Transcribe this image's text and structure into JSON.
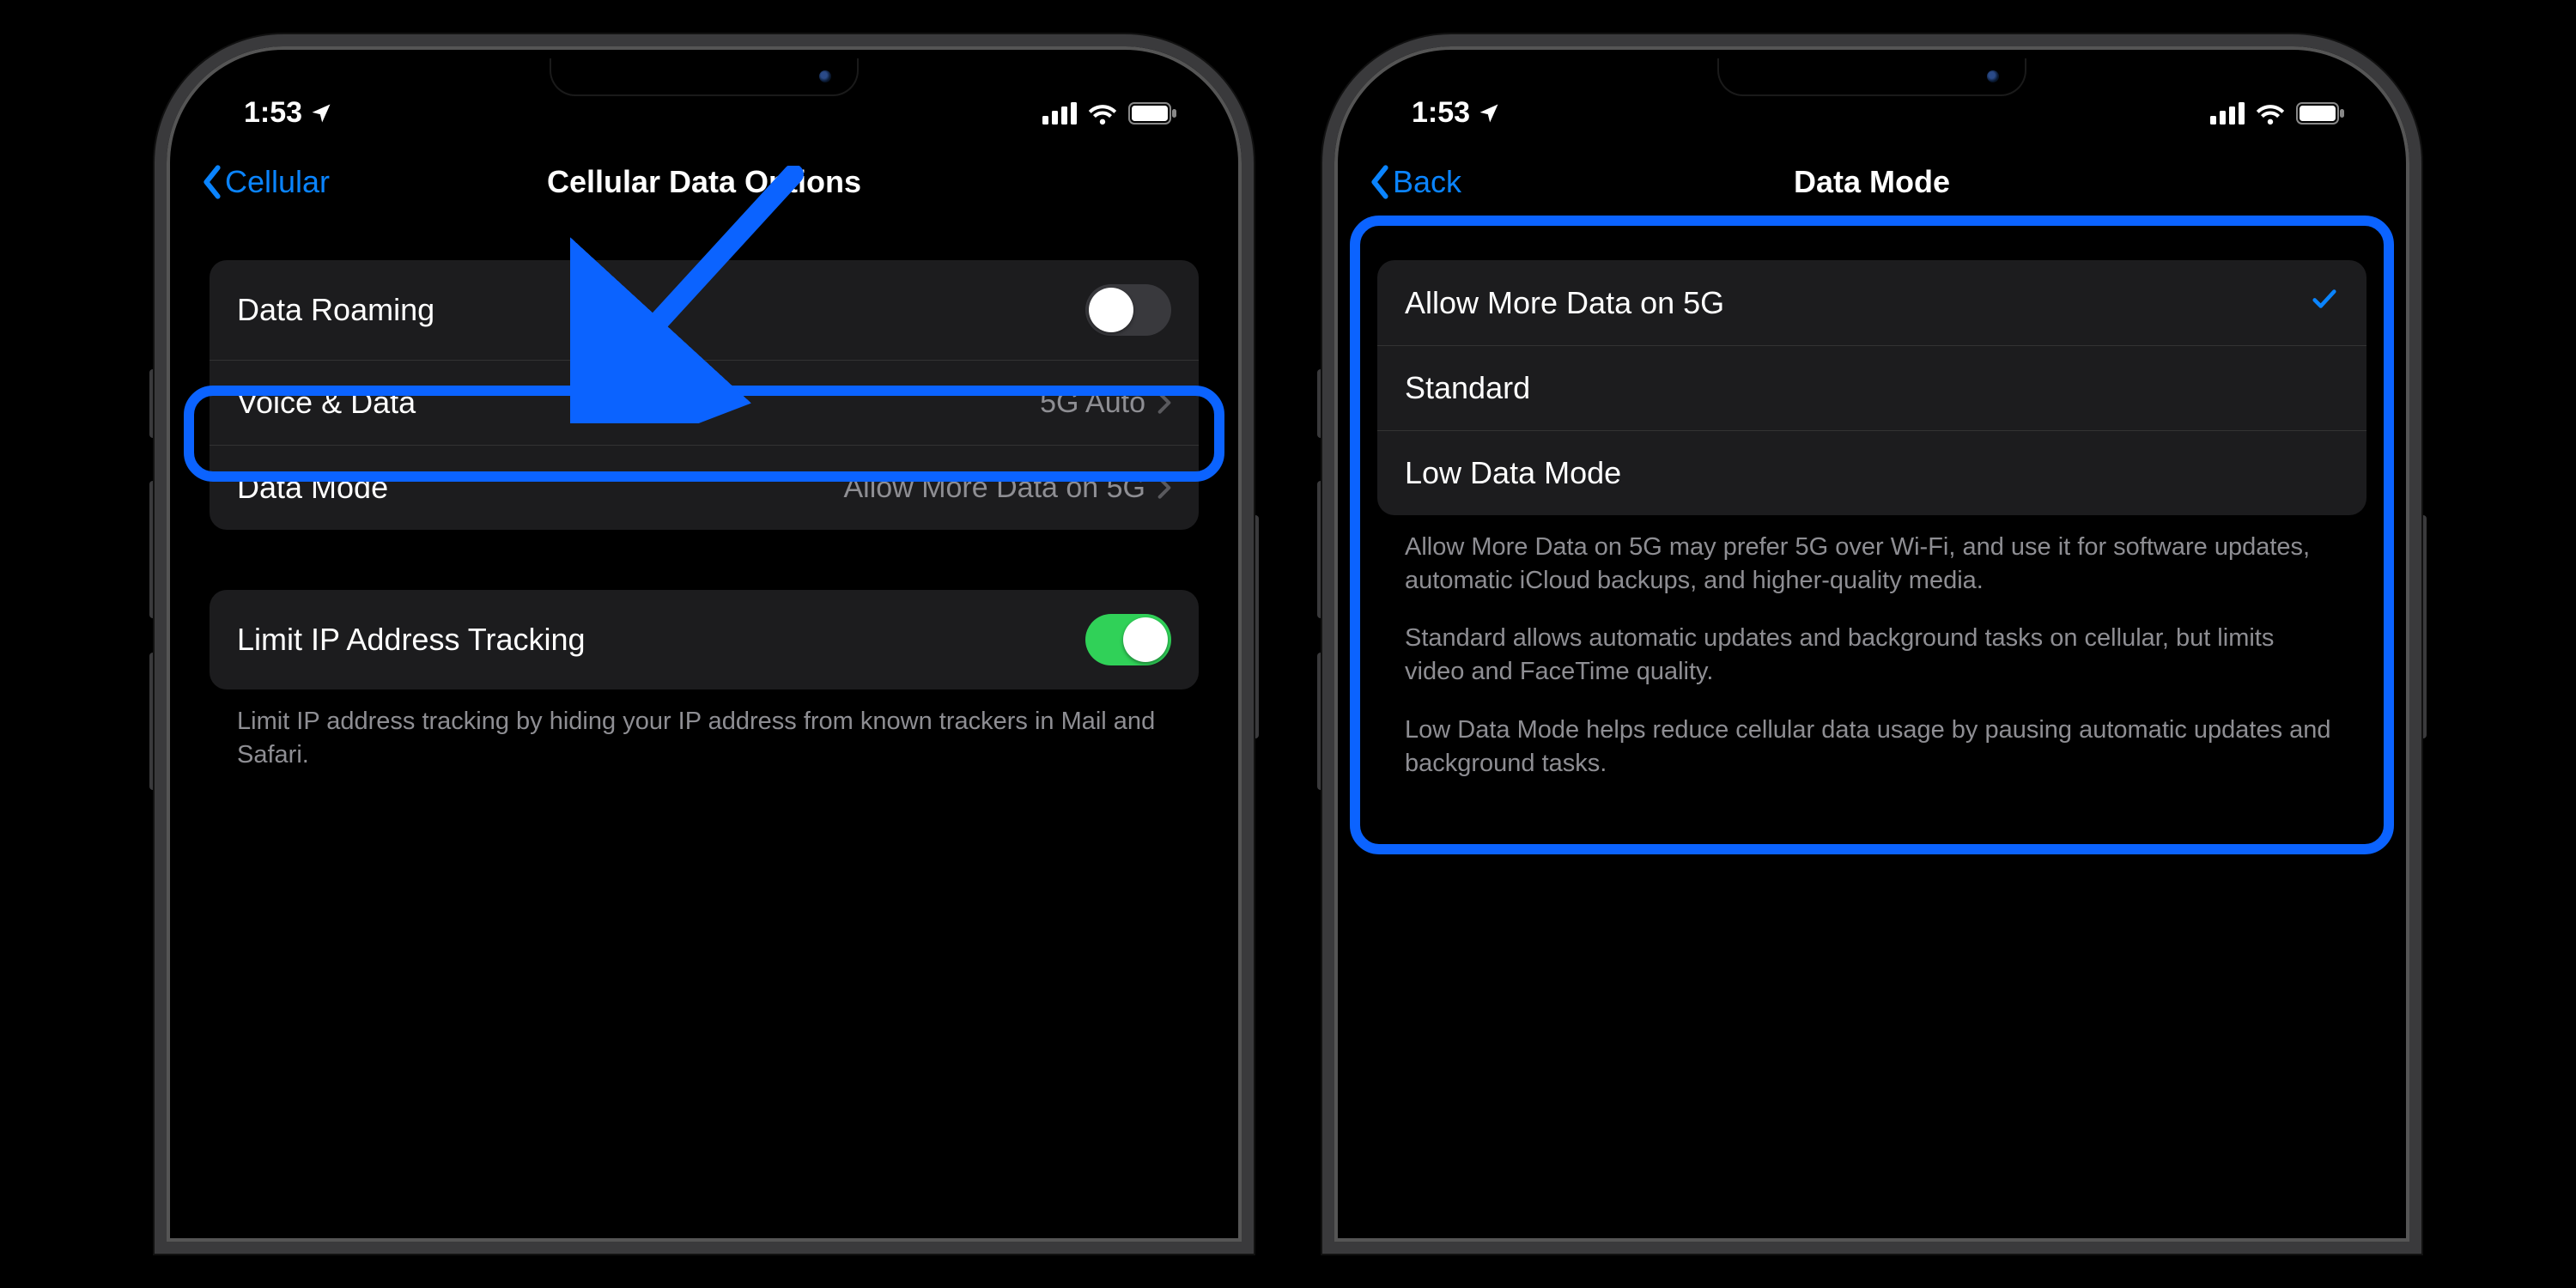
{
  "status": {
    "time": "1:53"
  },
  "left": {
    "backLabel": "Cellular",
    "title": "Cellular Data Options",
    "rows": {
      "roaming": "Data Roaming",
      "voiceData": "Voice & Data",
      "voiceDataValue": "5G Auto",
      "dataMode": "Data Mode",
      "dataModeValue": "Allow More Data on 5G",
      "limitIP": "Limit IP Address Tracking"
    },
    "footer": "Limit IP address tracking by hiding your IP address from known trackers in Mail and Safari."
  },
  "right": {
    "backLabel": "Back",
    "title": "Data Mode",
    "options": {
      "allowMore": "Allow More Data on 5G",
      "standard": "Standard",
      "lowData": "Low Data Mode"
    },
    "footer1": "Allow More Data on 5G may prefer 5G over Wi-Fi, and use it for software updates, automatic iCloud backups, and higher-quality media.",
    "footer2": "Standard allows automatic updates and background tasks on cellular, but limits video and FaceTime quality.",
    "footer3": "Low Data Mode helps reduce cellular data usage by pausing automatic updates and background tasks."
  }
}
